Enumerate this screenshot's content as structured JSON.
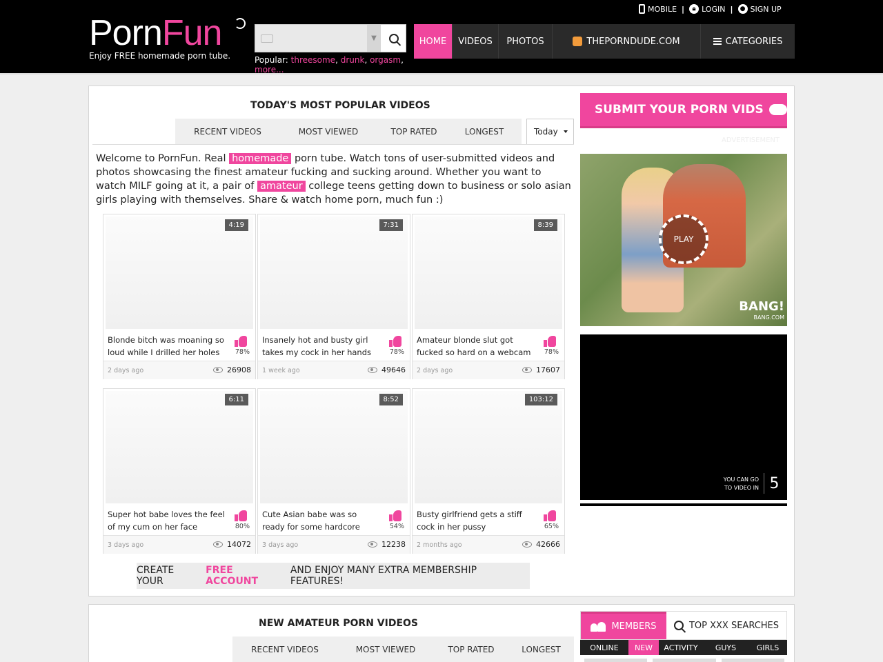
{
  "header": {
    "logo_part1": "Porn",
    "logo_part2": "Fun",
    "tagline": "Enjoy FREE homemade porn tube.",
    "top_links": {
      "mobile": "MOBILE",
      "login": "LOGIN",
      "signup": "SIGN UP"
    },
    "search": {
      "placeholder": ""
    },
    "popular_label": "Popular:",
    "popular_links": [
      "threesome",
      "drunk",
      "orgasm",
      "more"
    ],
    "nav": [
      "HOME",
      "VIDEOS",
      "PHOTOS",
      "THEPORNDUDE.COM",
      "CATEGORIES"
    ]
  },
  "popular_section": {
    "title": "TODAY'S MOST POPULAR VIDEOS",
    "tabs": [
      "RECENT VIDEOS",
      "MOST VIEWED",
      "TOP RATED",
      "LONGEST"
    ],
    "period": "Today"
  },
  "welcome": {
    "t1": "Welcome to PornFun. Real ",
    "hl1": "homemade",
    "t2": " porn tube. Watch tons of user-submitted videos and photos showcasing the finest amateur fucking and sucking around. Whether you want to watch MILF going at it, a pair of ",
    "hl2": "amateur",
    "t3": " college teens getting down to business or solo asian girls playing with themselves. Share & watch home porn, much fun :)"
  },
  "videos": [
    {
      "duration": "4:19",
      "title": "Blonde bitch was moaning so loud while I drilled her holes",
      "rating": "78%",
      "age": "2 days ago",
      "views": "26908"
    },
    {
      "duration": "7:31",
      "title": "Insanely hot and busty girl takes my cock in her hands",
      "rating": "78%",
      "age": "1 week ago",
      "views": "49646"
    },
    {
      "duration": "8:39",
      "title": "Amateur blonde slut got fucked so hard on a webcam",
      "rating": "78%",
      "age": "2 days ago",
      "views": "17607"
    },
    {
      "duration": "6:11",
      "title": "Super hot babe loves the feel of my cum on her face",
      "rating": "80%",
      "age": "3 days ago",
      "views": "14072"
    },
    {
      "duration": "8:52",
      "title": "Cute Asian babe was so ready for some hardcore action",
      "rating": "54%",
      "age": "3 days ago",
      "views": "12238"
    },
    {
      "duration": "103:12",
      "title": "Busty girlfriend gets a stiff cock in her pussy",
      "rating": "65%",
      "age": "2 months ago",
      "views": "42666"
    }
  ],
  "cta": {
    "t1": "CREATE YOUR",
    "pink": "FREE ACCOUNT",
    "t2": "AND ENJOY MANY EXTRA MEMBERSHIP FEATURES!"
  },
  "sidebar": {
    "submit": "SUBMIT YOUR PORN VIDS",
    "ad_label": "ADVERTISEMENT",
    "play": "PLAY",
    "bang": "BANG!",
    "bang_sub": "BANG.COM",
    "countdown_text": "YOU CAN GO TO VIDEO IN",
    "countdown": "5"
  },
  "new_section": {
    "title": "NEW AMATEUR PORN VIDEOS",
    "tabs": [
      "RECENT VIDEOS",
      "MOST VIEWED",
      "TOP RATED",
      "LONGEST"
    ]
  },
  "members": {
    "tabs": [
      "MEMBERS",
      "TOP XXX SEARCHES"
    ],
    "subtabs": [
      "ONLINE",
      "NEW",
      "ACTIVITY",
      "GUYS",
      "GIRLS"
    ]
  }
}
